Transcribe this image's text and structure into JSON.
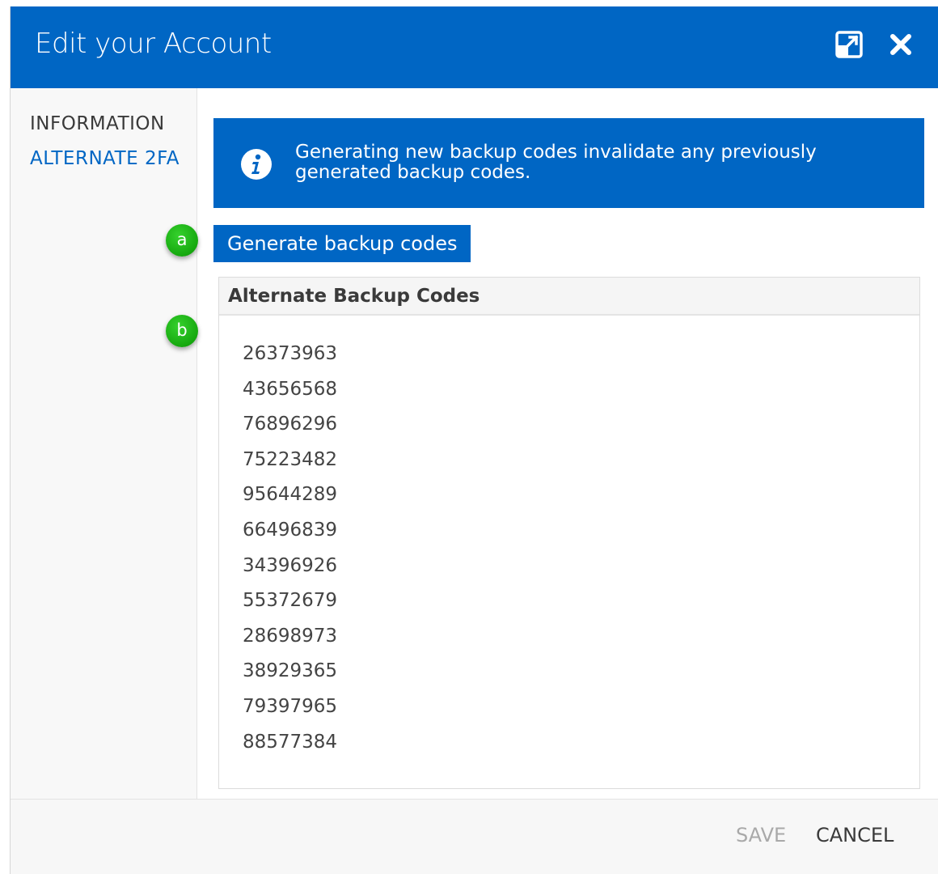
{
  "dialog": {
    "title": "Edit your Account",
    "maximize_icon": "maximize-icon",
    "close_icon": "close-icon"
  },
  "sidebar": {
    "items": [
      {
        "label": "INFORMATION"
      },
      {
        "label": "ALTERNATE 2FA"
      }
    ]
  },
  "info_banner": {
    "icon": "info-icon",
    "text": "Generating new backup codes invalidate any previously generated backup codes."
  },
  "generate_button": {
    "label": "Generate backup codes"
  },
  "backup_codes": {
    "header": "Alternate Backup Codes",
    "codes": [
      "26373963",
      "43656568",
      "76896296",
      "75223482",
      "95644289",
      "66496839",
      "34396926",
      "55372679",
      "28698973",
      "38929365",
      "79397965",
      "88577384"
    ]
  },
  "footer": {
    "save_label": "SAVE",
    "cancel_label": "CANCEL"
  },
  "callouts": {
    "a": "a",
    "b": "b"
  },
  "colors": {
    "primary": "#0066c4",
    "callout_green": "#16a80f",
    "disabled_text": "#a9a9a9"
  }
}
